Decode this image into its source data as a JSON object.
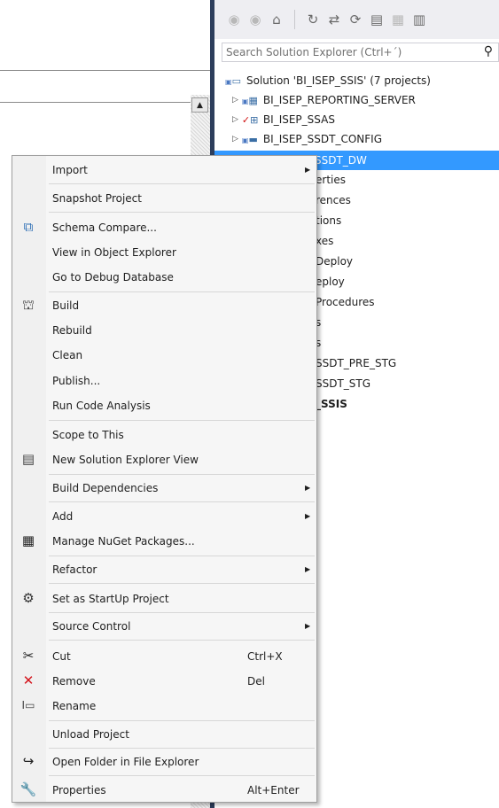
{
  "solution_explorer": {
    "search_placeholder": "Search Solution Explorer (Ctrl+´)",
    "toolbar_icons": [
      "back-icon",
      "forward-icon",
      "home-icon",
      "sync-icon",
      "switch-views-icon",
      "refresh-icon",
      "collapse-all-icon",
      "show-all-files-icon",
      "properties-icon"
    ],
    "tree": [
      {
        "label": "Solution 'BI_ISEP_SSIS' (7 projects)"
      },
      {
        "label": "BI_ISEP_REPORTING_SERVER"
      },
      {
        "label": "BI_ISEP_SSAS"
      },
      {
        "label": "BI_ISEP_SSDT_CONFIG"
      },
      {
        "label": "SSDT_DW"
      },
      {
        "label": "erties"
      },
      {
        "label": "rences"
      },
      {
        "label": "tions"
      },
      {
        "label": "xes"
      },
      {
        "label": "Deploy"
      },
      {
        "label": "eploy"
      },
      {
        "label": "Procedures"
      },
      {
        "label": "s"
      },
      {
        "label": "s"
      },
      {
        "label": "SSDT_PRE_STG"
      },
      {
        "label": "SSDT_STG"
      },
      {
        "label": "_SSIS"
      }
    ]
  },
  "context_menu": {
    "items": [
      {
        "label": "Import",
        "shortcut": "",
        "icon": ""
      },
      {
        "label": "Snapshot Project",
        "shortcut": "",
        "icon": ""
      },
      {
        "label": "Schema Compare...",
        "shortcut": "",
        "icon": "schema-compare-icon"
      },
      {
        "label": "View in Object Explorer",
        "shortcut": "",
        "icon": ""
      },
      {
        "label": "Go to Debug Database",
        "shortcut": "",
        "icon": ""
      },
      {
        "label": "Build",
        "shortcut": "",
        "icon": "build-icon"
      },
      {
        "label": "Rebuild",
        "shortcut": "",
        "icon": ""
      },
      {
        "label": "Clean",
        "shortcut": "",
        "icon": ""
      },
      {
        "label": "Publish...",
        "shortcut": "",
        "icon": ""
      },
      {
        "label": "Run Code Analysis",
        "shortcut": "",
        "icon": ""
      },
      {
        "label": "Scope to This",
        "shortcut": "",
        "icon": ""
      },
      {
        "label": "New Solution Explorer View",
        "shortcut": "",
        "icon": "new-view-icon"
      },
      {
        "label": "Build Dependencies",
        "shortcut": "",
        "icon": ""
      },
      {
        "label": "Add",
        "shortcut": "",
        "icon": ""
      },
      {
        "label": "Manage NuGet Packages...",
        "shortcut": "",
        "icon": "nuget-icon"
      },
      {
        "label": "Refactor",
        "shortcut": "",
        "icon": ""
      },
      {
        "label": "Set as StartUp Project",
        "shortcut": "",
        "icon": "gear-icon"
      },
      {
        "label": "Source Control",
        "shortcut": "",
        "icon": ""
      },
      {
        "label": "Cut",
        "shortcut": "Ctrl+X",
        "icon": "cut-icon"
      },
      {
        "label": "Remove",
        "shortcut": "Del",
        "icon": "remove-icon"
      },
      {
        "label": "Rename",
        "shortcut": "",
        "icon": "rename-icon"
      },
      {
        "label": "Unload Project",
        "shortcut": "",
        "icon": ""
      },
      {
        "label": "Open Folder in File Explorer",
        "shortcut": "",
        "icon": "open-folder-icon"
      },
      {
        "label": "Properties",
        "shortcut": "Alt+Enter",
        "icon": "wrench-icon"
      }
    ]
  }
}
